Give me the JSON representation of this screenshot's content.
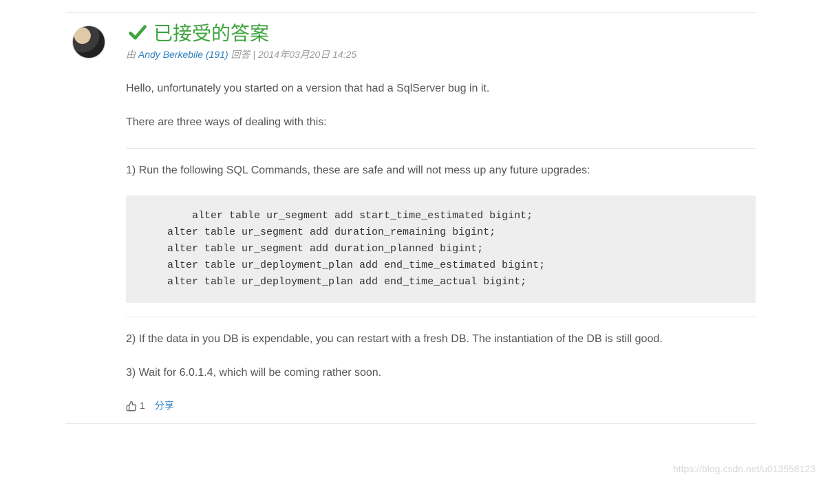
{
  "answer": {
    "title": "已接受的答案",
    "byline": {
      "prefix": "由 ",
      "author": "Andy Berkebile",
      "reputation": "(191)",
      "action": " 回答",
      "separator": " | ",
      "timestamp": "2014年03月20日 14:25"
    },
    "body": {
      "p1": "Hello, unfortunately you started on a version that had a SqlServer bug in it.",
      "p2": "There are three ways of dealing with this:",
      "p3": "1) Run the following SQL Commands, these are safe and will not mess up any future upgrades:",
      "code": "        alter table ur_segment add start_time_estimated bigint;\n    alter table ur_segment add duration_remaining bigint;\n    alter table ur_segment add duration_planned bigint;\n    alter table ur_deployment_plan add end_time_estimated bigint;\n    alter table ur_deployment_plan add end_time_actual bigint;",
      "p4": "2) If the data in you DB is expendable, you can restart with a fresh DB. The instantiation of the DB is still good.",
      "p5": "3) Wait for 6.0.1.4, which will be coming rather soon."
    },
    "actions": {
      "like_count": "1",
      "share_label": "分享"
    }
  },
  "watermark": "https://blog.csdn.net/u013558123"
}
